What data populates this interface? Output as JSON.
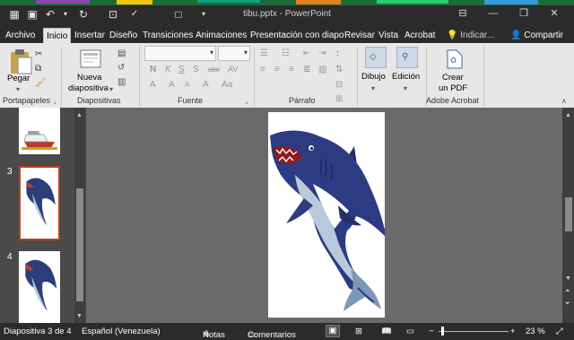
{
  "window": {
    "title": "tibu.pptx - PowerPoint"
  },
  "tabs": [
    "Archivo",
    "Inicio",
    "Insertar",
    "Diseño",
    "Transiciones",
    "Animaciones",
    "Presentación con diapo",
    "Revisar",
    "Vista",
    "Acrobat"
  ],
  "tell_me": "Indicar...",
  "share": "Compartir",
  "ribbon": {
    "paste_label": "Pegar",
    "new_slide_label_1": "Nueva",
    "new_slide_label_2": "diapositiva",
    "drawing_label": "Dibujo",
    "editing_label": "Edición",
    "create_pdf_1": "Crear",
    "create_pdf_2": "un PDF",
    "groups": {
      "clipboard": "Portapapeles",
      "slides": "Diapositivas",
      "font": "Fuente",
      "paragraph": "Párrafo",
      "acrobat": "Adobe Acrobat"
    }
  },
  "thumbnails": {
    "numbers": [
      "3",
      "4"
    ]
  },
  "status": {
    "slide_info": "Diapositiva 3 de 4",
    "language": "Español (Venezuela)",
    "notes": "Notas",
    "comments": "Comentarios",
    "zoom": "23 %"
  },
  "colors": {
    "accent": "#c43e1c",
    "titlebar": "#2b2b2b",
    "ribbon": "#e7e7e7"
  }
}
